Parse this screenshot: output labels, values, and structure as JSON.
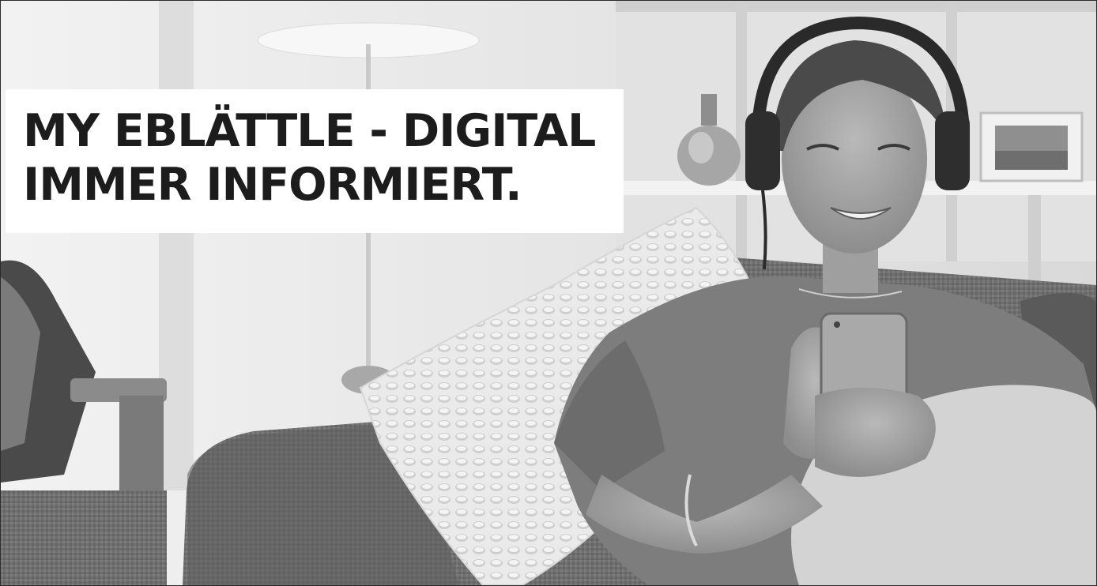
{
  "banner": {
    "headline_line1": "MY EBLÄTTLE - DIGITAL",
    "headline_line2": "IMMER INFORMIERT.",
    "photo_description": "woman-with-headphones-on-couch-using-smartphone",
    "colors": {
      "text": "#1c1c1c",
      "box": "#ffffff",
      "photo_tone": "grayscale"
    }
  }
}
